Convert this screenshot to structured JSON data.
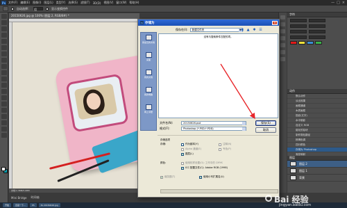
{
  "app": {
    "logo": "Ps",
    "menu": [
      "文件(F)",
      "编辑(E)",
      "图像(I)",
      "图层(L)",
      "类型(Y)",
      "选择(S)",
      "滤镜(T)",
      "3D(D)",
      "视图(V)",
      "窗口(W)",
      "帮助(H)"
    ],
    "window_controls": [
      "—",
      "□",
      "×"
    ]
  },
  "options_bar": {
    "auto_select_label": "自动选择：",
    "auto_select_value": "组",
    "transform_label": "显示变换控件"
  },
  "document": {
    "tab_label": "20150626.jpg @ 100% (图层 2, RGB/8#) *",
    "status": "文档:1.38M/5.08M"
  },
  "bottom_tabs": [
    "Mini Bridge",
    "时间轴"
  ],
  "taskbar": [
    "开始",
    "百度一下...",
    "PS",
    "Ps 20150626.jpg"
  ],
  "panels": {
    "character_title": "字符",
    "actions_title": "动作",
    "layers_title": "图层",
    "actions": [
      "默认动作",
      "淡出效果",
      "画框通道",
      "木质画框",
      "投影(文字)",
      "水中倒影",
      "自定义 RGB",
      "熔化的铅块",
      "制作剪贴路径",
      "棕褐色调",
      "四分颜色",
      "存储为 Photoshop",
      "渐变映射",
      "混合器画笔"
    ],
    "layers": [
      {
        "name": "图层 2",
        "selected": true
      },
      {
        "name": "图层 1",
        "selected": false
      },
      {
        "name": "背景",
        "selected": false
      }
    ],
    "swatch_colors": [
      "#e21a1a",
      "#f0e23a",
      "#3b8ed6",
      "#3bb54a"
    ]
  },
  "dialog": {
    "title": "存储为",
    "save_in_label": "保存在(I):",
    "save_in_value": "新建文件夹",
    "nav_icons": [
      "back-icon",
      "up-folder-icon",
      "new-folder-icon",
      "view-menu-icon"
    ],
    "empty_message": "没有与搜索条件匹配的项。",
    "places": [
      "我最近的文档",
      "桌面",
      "我的文档",
      "我的电脑",
      "网上邻居"
    ],
    "filename_label": "文件名(N):",
    "filename_value": "20150626.psd",
    "format_label": "格式(F):",
    "format_value": "Photoshop (*.PSD;*.PDD)",
    "save_button": "保存(S)",
    "cancel_button": "取消",
    "save_options_label": "存储选项",
    "save_label": "存储:",
    "opt_as_copy": "作为副本(Y)",
    "opt_notes": "注释(N)",
    "opt_alpha": "Alpha 通道(E)",
    "opt_spot": "专色(P)",
    "opt_layers": "图层(L)",
    "color_label": "颜色:",
    "opt_proof": "使用校样设置(O): 工作中的 CMYK",
    "opt_icc": "ICC 配置文件(C): Adobe RGB (1998)",
    "opt_thumbnail": "缩览图(T)",
    "opt_lowercase": "使用小写扩展名(U)"
  },
  "watermark": {
    "brand": "Bai 经验",
    "url": "jingyan.baidu.com"
  },
  "accent": {
    "arrow_color": "#e8262a",
    "titlebar_color": "#1a4fb5"
  }
}
